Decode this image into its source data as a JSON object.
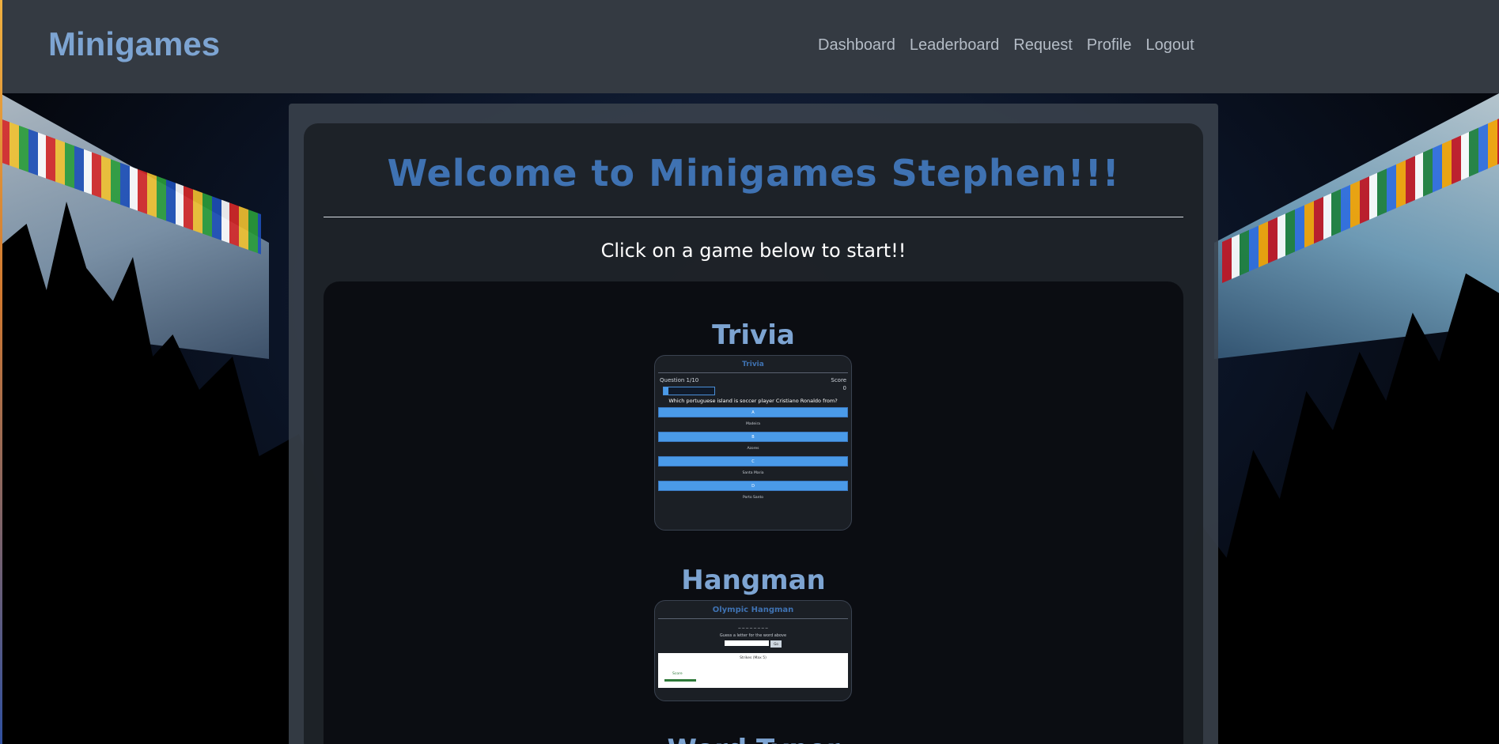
{
  "app": {
    "brand": "Minigames"
  },
  "nav": {
    "items": [
      {
        "label": "Dashboard"
      },
      {
        "label": "Leaderboard"
      },
      {
        "label": "Request"
      },
      {
        "label": "Profile"
      },
      {
        "label": "Logout"
      }
    ]
  },
  "main": {
    "welcome": "Welcome to Minigames Stephen!!!",
    "subtitle": "Click on a game below to start!!"
  },
  "games": [
    {
      "title": "Trivia",
      "preview": {
        "header": "Trivia",
        "question_counter": "Question 1/10",
        "score_label": "Score",
        "score_value": "0",
        "progress_fraction": 0.1,
        "question": "Which portuguese island is soccer player Cristiano Ronaldo from?",
        "options": [
          {
            "button": "A",
            "answer": "Madeira"
          },
          {
            "button": "B",
            "answer": "Azores"
          },
          {
            "button": "C",
            "answer": "Santa Maria"
          },
          {
            "button": "D",
            "answer": "Porto Santo"
          }
        ]
      }
    },
    {
      "title": "Hangman",
      "preview": {
        "header": "Olympic Hangman",
        "word": "_ _ _ _ _ _ _ _",
        "guess_prompt": "Guess a letter for the word above",
        "submit": "Go",
        "strikes": "Strikes (Max 5)",
        "score_label": "Score"
      }
    },
    {
      "title": "Word Typer"
    }
  ],
  "colors": {
    "brand": "#7da4d2",
    "heading": "#3f72b2",
    "navbar": "#343a42",
    "button": "#4a9ae8"
  }
}
